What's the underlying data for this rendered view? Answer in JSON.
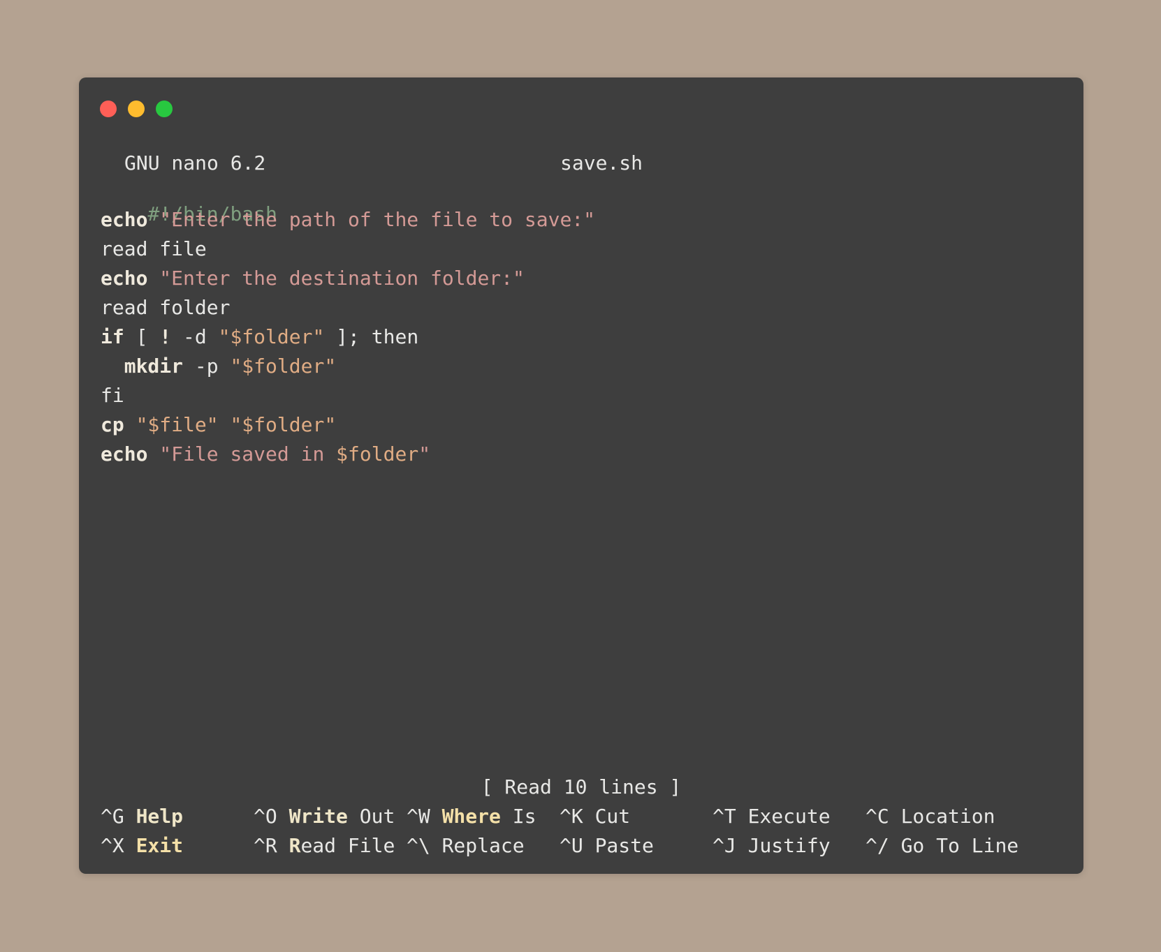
{
  "window": {
    "controls": {
      "close": "close-icon",
      "minimize": "minimize-icon",
      "maximize": "maximize-icon"
    },
    "colors": {
      "close": "#ff5f57",
      "minimize": "#febc2e",
      "maximize": "#28c840"
    }
  },
  "header": {
    "app": "GNU nano 6.2",
    "filename": "save.sh"
  },
  "code": {
    "l1": "#!/bin/bash",
    "l2_cmd": "echo",
    "l2_str": "\"Enter the path of the file to save:\"",
    "l3": "read file",
    "l4_cmd": "echo",
    "l4_str": "\"Enter the destination folder:\"",
    "l5": "read folder",
    "l6_kw": "if",
    "l6_a": " [ ",
    "l6_bang": "!",
    "l6_b": " -d ",
    "l6_var": "\"$folder\"",
    "l6_c": " ]; then",
    "l7_indent": "  ",
    "l7_cmd": "mkdir",
    "l7_a": " -p ",
    "l7_var": "\"$folder\"",
    "l8": "fi",
    "l9_cmd": "cp",
    "l9_var1": "\"$file\"",
    "l9_var2": "\"$folder\"",
    "l10_cmd": "echo",
    "l10_str": "\"File saved in ",
    "l10_var": "$folder",
    "l10_end": "\""
  },
  "status": "[ Read 10 lines ]",
  "shortcuts": {
    "help_key": "^G",
    "help_label": "Help",
    "exit_key": "^X",
    "exit_label": "Exit",
    "write_key": "^O",
    "write_a": "Write",
    "write_b": " Out",
    "readfile_key": "^R",
    "readfile_a": "R",
    "readfile_b": "ead File",
    "where_key": "^W",
    "where_a": "Where",
    "where_b": " Is",
    "replace_key": "^\\",
    "replace_label": "Replace",
    "cut_key": "^K",
    "cut_label": "Cut",
    "paste_key": "^U",
    "paste_label": "Paste",
    "execute_key": "^T",
    "execute_label": "Execute",
    "justify_key": "^J",
    "justify_label": "Justify",
    "location_key": "^C",
    "location_label": "Location",
    "goto_key": "^/",
    "goto_label": "Go To Line"
  }
}
